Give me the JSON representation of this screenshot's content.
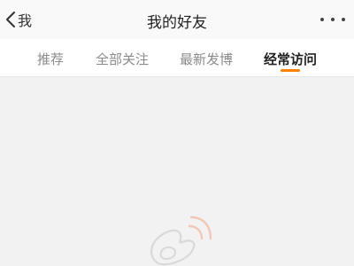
{
  "navbar": {
    "back_label": "我",
    "title": "我的好友",
    "back_icon": "chevron-left-icon",
    "more_icon": "more-horizontal-icon"
  },
  "tabs": [
    {
      "label": "推荐",
      "active": false
    },
    {
      "label": "全部关注",
      "active": false
    },
    {
      "label": "最新发博",
      "active": false
    },
    {
      "label": "经常访问",
      "active": true
    }
  ],
  "colors": {
    "accent": "#ff8200",
    "background": "#f2f2f2"
  },
  "empty_state": {
    "icon": "weibo-logo-icon"
  }
}
